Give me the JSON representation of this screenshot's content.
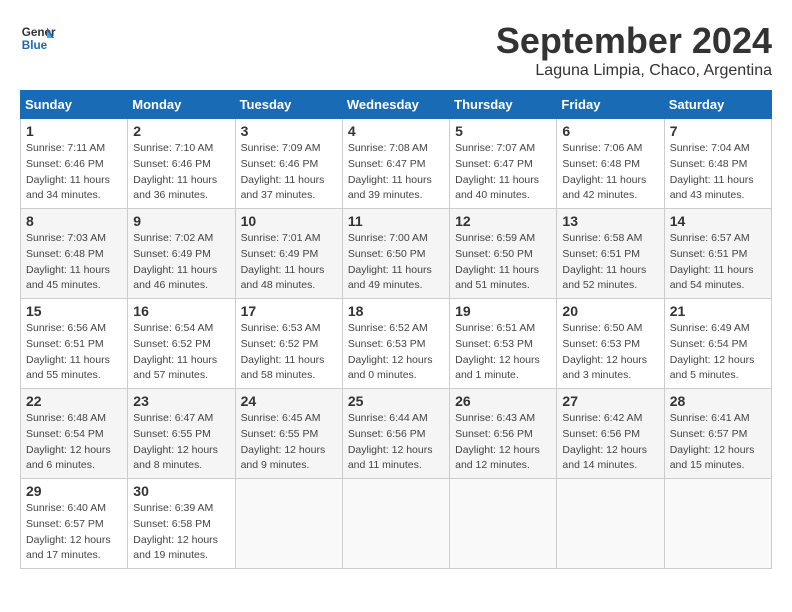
{
  "logo": {
    "line1": "General",
    "line2": "Blue"
  },
  "title": "September 2024",
  "subtitle": "Laguna Limpia, Chaco, Argentina",
  "days_of_week": [
    "Sunday",
    "Monday",
    "Tuesday",
    "Wednesday",
    "Thursday",
    "Friday",
    "Saturday"
  ],
  "weeks": [
    [
      {
        "day": 1,
        "info": "Sunrise: 7:11 AM\nSunset: 6:46 PM\nDaylight: 11 hours\nand 34 minutes."
      },
      {
        "day": 2,
        "info": "Sunrise: 7:10 AM\nSunset: 6:46 PM\nDaylight: 11 hours\nand 36 minutes."
      },
      {
        "day": 3,
        "info": "Sunrise: 7:09 AM\nSunset: 6:46 PM\nDaylight: 11 hours\nand 37 minutes."
      },
      {
        "day": 4,
        "info": "Sunrise: 7:08 AM\nSunset: 6:47 PM\nDaylight: 11 hours\nand 39 minutes."
      },
      {
        "day": 5,
        "info": "Sunrise: 7:07 AM\nSunset: 6:47 PM\nDaylight: 11 hours\nand 40 minutes."
      },
      {
        "day": 6,
        "info": "Sunrise: 7:06 AM\nSunset: 6:48 PM\nDaylight: 11 hours\nand 42 minutes."
      },
      {
        "day": 7,
        "info": "Sunrise: 7:04 AM\nSunset: 6:48 PM\nDaylight: 11 hours\nand 43 minutes."
      }
    ],
    [
      {
        "day": 8,
        "info": "Sunrise: 7:03 AM\nSunset: 6:48 PM\nDaylight: 11 hours\nand 45 minutes."
      },
      {
        "day": 9,
        "info": "Sunrise: 7:02 AM\nSunset: 6:49 PM\nDaylight: 11 hours\nand 46 minutes."
      },
      {
        "day": 10,
        "info": "Sunrise: 7:01 AM\nSunset: 6:49 PM\nDaylight: 11 hours\nand 48 minutes."
      },
      {
        "day": 11,
        "info": "Sunrise: 7:00 AM\nSunset: 6:50 PM\nDaylight: 11 hours\nand 49 minutes."
      },
      {
        "day": 12,
        "info": "Sunrise: 6:59 AM\nSunset: 6:50 PM\nDaylight: 11 hours\nand 51 minutes."
      },
      {
        "day": 13,
        "info": "Sunrise: 6:58 AM\nSunset: 6:51 PM\nDaylight: 11 hours\nand 52 minutes."
      },
      {
        "day": 14,
        "info": "Sunrise: 6:57 AM\nSunset: 6:51 PM\nDaylight: 11 hours\nand 54 minutes."
      }
    ],
    [
      {
        "day": 15,
        "info": "Sunrise: 6:56 AM\nSunset: 6:51 PM\nDaylight: 11 hours\nand 55 minutes."
      },
      {
        "day": 16,
        "info": "Sunrise: 6:54 AM\nSunset: 6:52 PM\nDaylight: 11 hours\nand 57 minutes."
      },
      {
        "day": 17,
        "info": "Sunrise: 6:53 AM\nSunset: 6:52 PM\nDaylight: 11 hours\nand 58 minutes."
      },
      {
        "day": 18,
        "info": "Sunrise: 6:52 AM\nSunset: 6:53 PM\nDaylight: 12 hours\nand 0 minutes."
      },
      {
        "day": 19,
        "info": "Sunrise: 6:51 AM\nSunset: 6:53 PM\nDaylight: 12 hours\nand 1 minute."
      },
      {
        "day": 20,
        "info": "Sunrise: 6:50 AM\nSunset: 6:53 PM\nDaylight: 12 hours\nand 3 minutes."
      },
      {
        "day": 21,
        "info": "Sunrise: 6:49 AM\nSunset: 6:54 PM\nDaylight: 12 hours\nand 5 minutes."
      }
    ],
    [
      {
        "day": 22,
        "info": "Sunrise: 6:48 AM\nSunset: 6:54 PM\nDaylight: 12 hours\nand 6 minutes."
      },
      {
        "day": 23,
        "info": "Sunrise: 6:47 AM\nSunset: 6:55 PM\nDaylight: 12 hours\nand 8 minutes."
      },
      {
        "day": 24,
        "info": "Sunrise: 6:45 AM\nSunset: 6:55 PM\nDaylight: 12 hours\nand 9 minutes."
      },
      {
        "day": 25,
        "info": "Sunrise: 6:44 AM\nSunset: 6:56 PM\nDaylight: 12 hours\nand 11 minutes."
      },
      {
        "day": 26,
        "info": "Sunrise: 6:43 AM\nSunset: 6:56 PM\nDaylight: 12 hours\nand 12 minutes."
      },
      {
        "day": 27,
        "info": "Sunrise: 6:42 AM\nSunset: 6:56 PM\nDaylight: 12 hours\nand 14 minutes."
      },
      {
        "day": 28,
        "info": "Sunrise: 6:41 AM\nSunset: 6:57 PM\nDaylight: 12 hours\nand 15 minutes."
      }
    ],
    [
      {
        "day": 29,
        "info": "Sunrise: 6:40 AM\nSunset: 6:57 PM\nDaylight: 12 hours\nand 17 minutes."
      },
      {
        "day": 30,
        "info": "Sunrise: 6:39 AM\nSunset: 6:58 PM\nDaylight: 12 hours\nand 19 minutes."
      },
      null,
      null,
      null,
      null,
      null
    ]
  ]
}
